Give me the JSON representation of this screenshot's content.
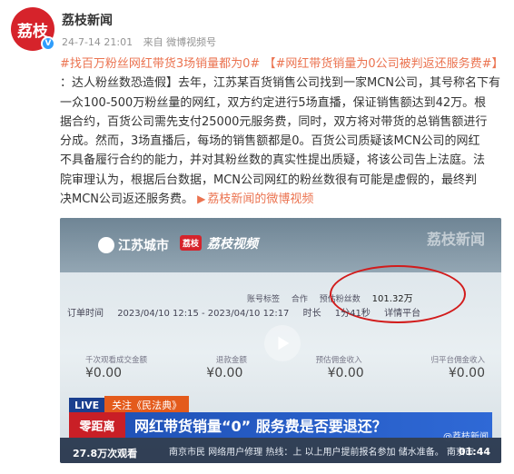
{
  "author": {
    "avatar_text": "荔枝",
    "name": "荔枝新闻",
    "verified_mark": "V"
  },
  "meta": {
    "time": "24-7-14 21:01",
    "source": "来自 微博视频号"
  },
  "post": {
    "tag1": "#找百万粉丝网红带货3场销量都为0#",
    "tag2": "【#网红带货销量为0公司被判返还服务费#】",
    "lines": [
      "：达人粉丝数恐造假】去年，江苏某百货销售公司找到一家MCN公司，其号称名下有",
      "一众100-500万粉丝量的网红，双方约定进行5场直播，保证销售额达到42万。根",
      "据合约，百货公司需先支付25000元服务费，同时，双方将对带货的总销售额进行",
      "分成。然而，3场直播后，每场的销售额都是0。百货公司质疑该MCN公司的网红",
      "不具备履行合约的能力，并对其粉丝数的真实性提出质疑，将该公司告上法庭。法",
      "院审理认为，根据后台数据，MCN公司网红的粉丝数很有可能是虚假的，最终判"
    ],
    "last_line": "决MCN公司返还服务费。",
    "video_link": "荔枝新闻的微博视频"
  },
  "video": {
    "logo_left": "江苏城市",
    "logo_right_badge": "荔枝",
    "logo_right": "荔枝视频",
    "watermark": "荔枝新闻",
    "row1": [
      "账号标签",
      "合作",
      "预估粉丝数",
      "101.32万"
    ],
    "row2": [
      "订单时间",
      "2023/04/10 12:15 - 2023/04/10 12:17",
      "时长",
      "1分41秒",
      "详情平台"
    ],
    "labels": [
      "千次观看成交金额",
      "退款金额",
      "预估佣金收入",
      "归平台佣金收入"
    ],
    "values": [
      "¥0.00",
      "¥0.00",
      "¥0.00",
      "¥0.00"
    ],
    "live_tag": "LIVE",
    "attention": "关注《民法典》",
    "channel": "零距离",
    "headline": "网红带货销量“0”  服务费是否要退还？",
    "ticker": "南京市民 网络用户修理  热线：上 以上用户提前报名参加 储水准备。 南京市",
    "views": "27.8万次观看",
    "duration": "01:44",
    "weibo_watermark": "@荔枝新闻"
  },
  "colors": {
    "accent": "#eb7350",
    "avatar_bg": "#d6232b",
    "verified": "#2f9dfb",
    "meta_text": "#939393"
  }
}
